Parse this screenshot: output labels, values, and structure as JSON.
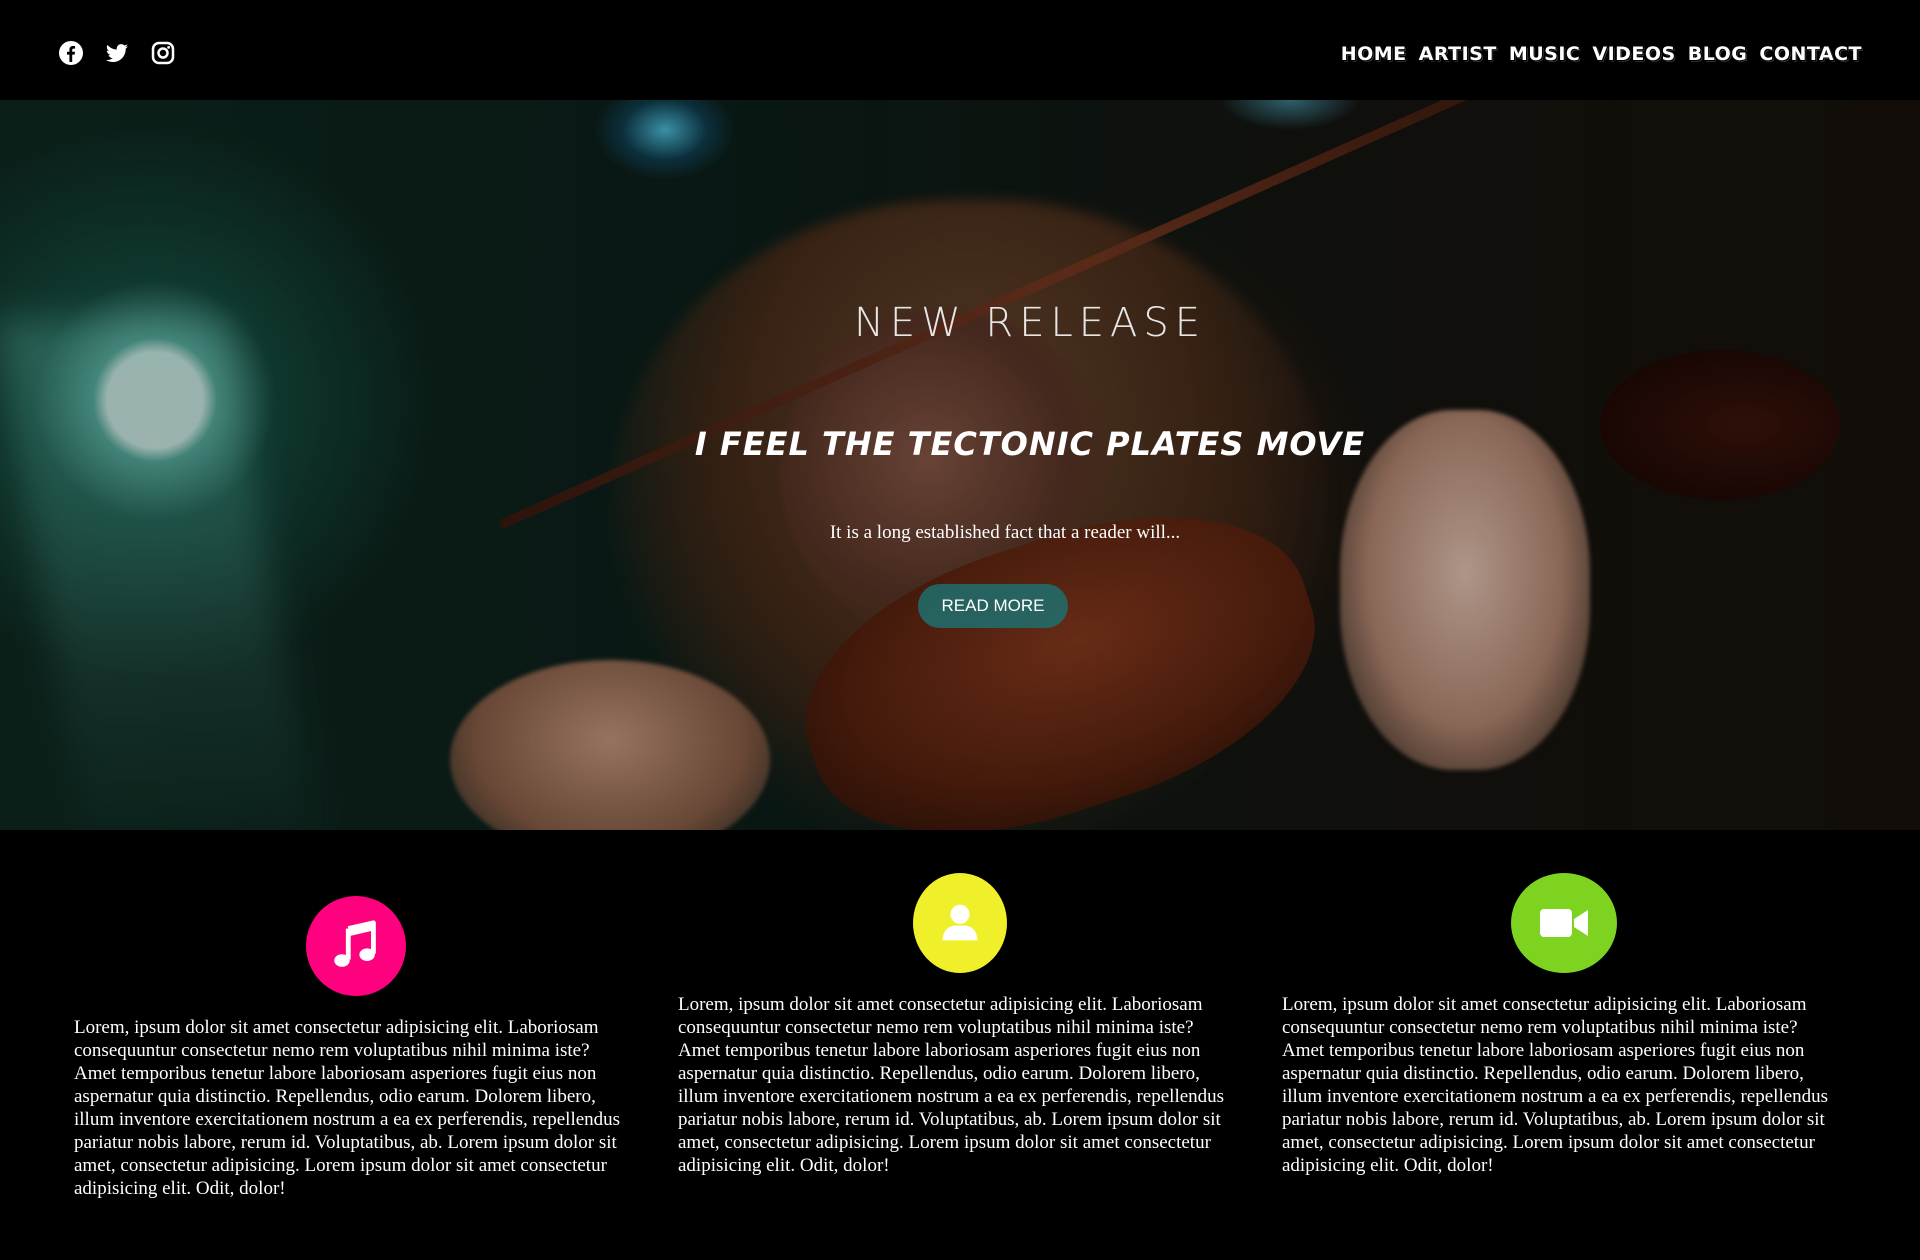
{
  "header": {
    "social": [
      {
        "icon": "facebook-icon"
      },
      {
        "icon": "twitter-icon"
      },
      {
        "icon": "instagram-icon"
      }
    ],
    "nav": [
      "HOME",
      "ARTIST",
      "MUSIC",
      "VIDEOS",
      "BLOG",
      "CONTACT"
    ]
  },
  "hero": {
    "eyebrow": "NEW RELEASE",
    "headline": "I FEEL THE TECTONIC PLATES MOVE",
    "tagline": "It is a long established fact that a reader will...",
    "button_label": "READ MORE"
  },
  "features": [
    {
      "icon": "music-note-icon",
      "color": "#ff007f",
      "text": "Lorem, ipsum dolor sit amet consectetur adipisicing elit. Laboriosam consequuntur consectetur nemo rem voluptatibus nihil minima iste? Amet temporibus tenetur labore laboriosam asperiores fugit eius non aspernatur quia distinctio. Repellendus, odio earum. Dolorem libero, illum inventore exercitationem nostrum a ea ex perferendis, repellendus pariatur nobis labore, rerum id. Voluptatibus, ab. Lorem ipsum dolor sit amet, consectetur adipisicing. Lorem ipsum dolor sit amet consectetur adipisicing elit. Odit, dolor!"
    },
    {
      "icon": "user-icon",
      "color": "#f0f02a",
      "text": "Lorem, ipsum dolor sit amet consectetur adipisicing elit. Laboriosam consequuntur consectetur nemo rem voluptatibus nihil minima iste? Amet temporibus tenetur labore laboriosam asperiores fugit eius non aspernatur quia distinctio. Repellendus, odio earum. Dolorem libero, illum inventore exercitationem nostrum a ea ex perferendis, repellendus pariatur nobis labore, rerum id. Voluptatibus, ab. Lorem ipsum dolor sit amet, consectetur adipisicing. Lorem ipsum dolor sit amet consectetur adipisicing elit. Odit, dolor!"
    },
    {
      "icon": "video-camera-icon",
      "color": "#7ed321",
      "text": "Lorem, ipsum dolor sit amet consectetur adipisicing elit. Laboriosam consequuntur consectetur nemo rem voluptatibus nihil minima iste? Amet temporibus tenetur labore laboriosam asperiores fugit eius non aspernatur quia distinctio. Repellendus, odio earum. Dolorem libero, illum inventore exercitationem nostrum a ea ex perferendis, repellendus pariatur nobis labore, rerum id. Voluptatibus, ab. Lorem ipsum dolor sit amet, consectetur adipisicing. Lorem ipsum dolor sit amet consectetur adipisicing elit. Odit, dolor!"
    }
  ]
}
